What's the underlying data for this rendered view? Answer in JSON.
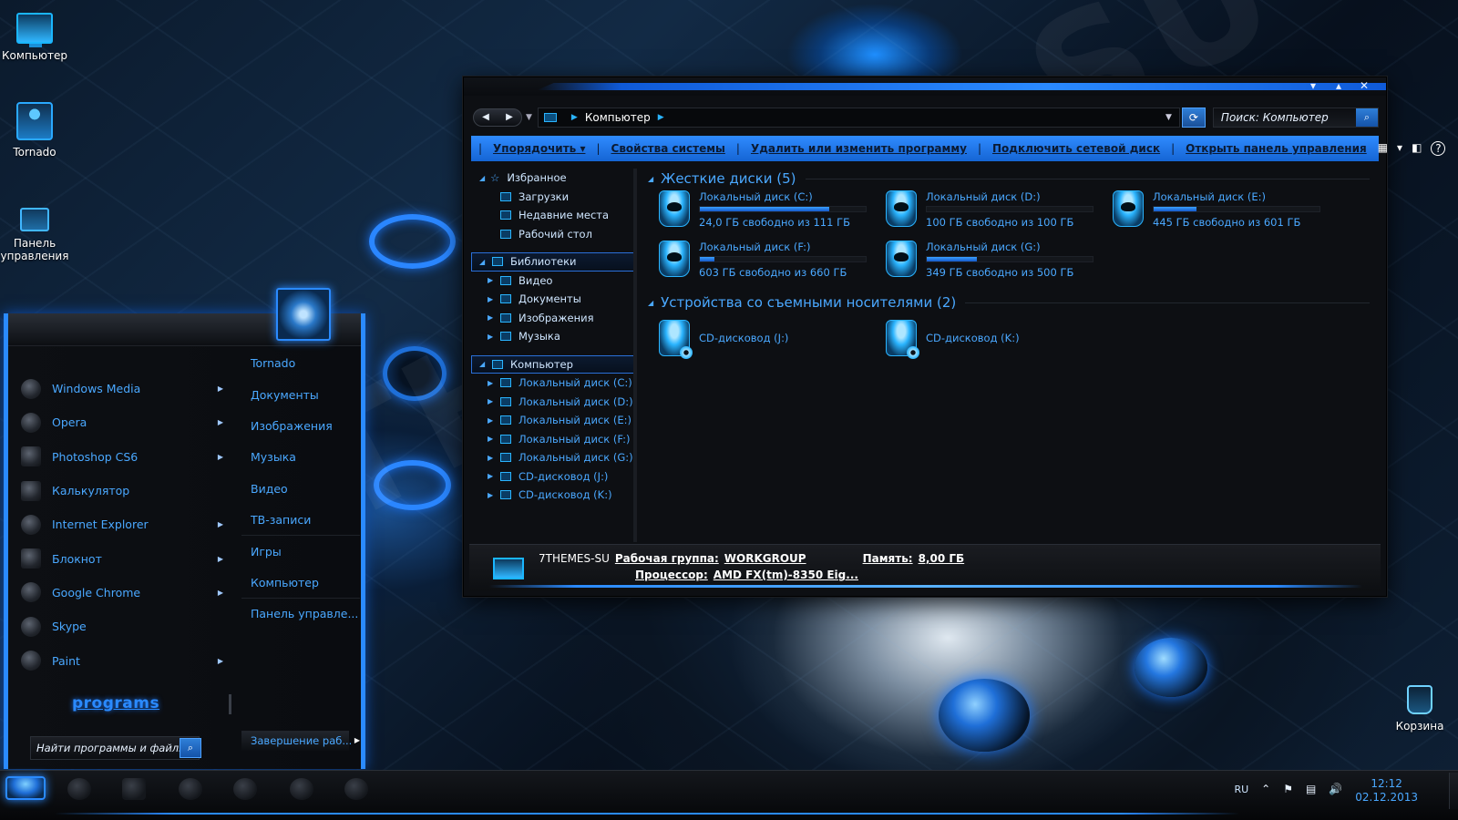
{
  "desktop": {
    "icons": [
      {
        "label": "Компьютер",
        "icon": "computer-icon"
      },
      {
        "label": "Tornado",
        "icon": "user-icon"
      },
      {
        "label": "Панель управления",
        "icon": "control-panel-icon"
      },
      {
        "label": "Корзина",
        "icon": "recycle-bin-icon"
      }
    ],
    "watermark": "7THEMES.SU"
  },
  "explorer": {
    "address": {
      "location": "Компьютер"
    },
    "search": {
      "placeholder": "Поиск: Компьютер"
    },
    "commands": [
      {
        "label": "Упорядочить",
        "dropdown": true
      },
      {
        "label": "Свойства системы"
      },
      {
        "label": "Удалить или изменить программу"
      },
      {
        "label": "Подключить сетевой диск"
      },
      {
        "label": "Открыть панель управления"
      }
    ],
    "nav": {
      "favorites": {
        "label": "Избранное",
        "items": [
          "Загрузки",
          "Недавние места",
          "Рабочий стол"
        ]
      },
      "libraries": {
        "label": "Библиотеки",
        "items": [
          "Видео",
          "Документы",
          "Изображения",
          "Музыка"
        ]
      },
      "computer": {
        "label": "Компьютер",
        "items": [
          "Локальный диск (C:)",
          "Локальный диск (D:)",
          "Локальный диск (E:)",
          "Локальный диск (F:)",
          "Локальный диск (G:)",
          "CD-дисковод (J:)",
          "CD-дисковод (K:)"
        ]
      }
    },
    "hard_disks": {
      "title": "Жесткие диски (5)",
      "drives": [
        {
          "name": "Локальный диск (C:)",
          "free": "24,0 ГБ свободно из 111 ГБ",
          "used_fraction": 0.78
        },
        {
          "name": "Локальный диск (D:)",
          "free": "100 ГБ свободно из 100 ГБ",
          "used_fraction": 0.0
        },
        {
          "name": "Локальный диск (E:)",
          "free": "445 ГБ свободно из 601 ГБ",
          "used_fraction": 0.26
        },
        {
          "name": "Локальный диск (F:)",
          "free": "603 ГБ свободно из 660 ГБ",
          "used_fraction": 0.09
        },
        {
          "name": "Локальный диск (G:)",
          "free": "349 ГБ свободно из 500 ГБ",
          "used_fraction": 0.3
        }
      ]
    },
    "removable": {
      "title": "Устройства со съемными носителями (2)",
      "drives": [
        {
          "name": "CD-дисковод (J:)"
        },
        {
          "name": "CD-дисковод (K:)"
        }
      ]
    },
    "details": {
      "computer_name": "7THEMES-SU",
      "workgroup_label": "Рабочая группа:",
      "workgroup_value": "WORKGROUP",
      "memory_label": "Память:",
      "memory_value": "8,00 ГБ",
      "cpu_label": "Процессор:",
      "cpu_value": "AMD FX(tm)-8350 Eig..."
    }
  },
  "start_menu": {
    "programs": [
      {
        "label": "Windows Media",
        "submenu": true
      },
      {
        "label": "Opera",
        "submenu": true
      },
      {
        "label": "Photoshop CS6",
        "submenu": true
      },
      {
        "label": "Калькулятор",
        "submenu": false
      },
      {
        "label": "Internet Explorer",
        "submenu": true
      },
      {
        "label": "Блокнот",
        "submenu": true
      },
      {
        "label": "Google Chrome",
        "submenu": true
      },
      {
        "label": "Skype",
        "submenu": false
      },
      {
        "label": "Paint",
        "submenu": true
      }
    ],
    "links": [
      "Tornado",
      "Документы",
      "Изображения",
      "Музыка",
      "Видео",
      "ТВ-записи",
      "Игры",
      "Компьютер",
      "Панель управле..."
    ],
    "programs_label": "programs",
    "search_placeholder": "Найти программы и файлы",
    "shutdown_label": "Завершение раб..."
  },
  "taskbar": {
    "language": "RU",
    "time": "12:12",
    "date": "02.12.2013"
  },
  "colors": {
    "accent": "#2a8aff",
    "text_blue": "#4aa8ff",
    "command_bar": "#1f78e8"
  }
}
